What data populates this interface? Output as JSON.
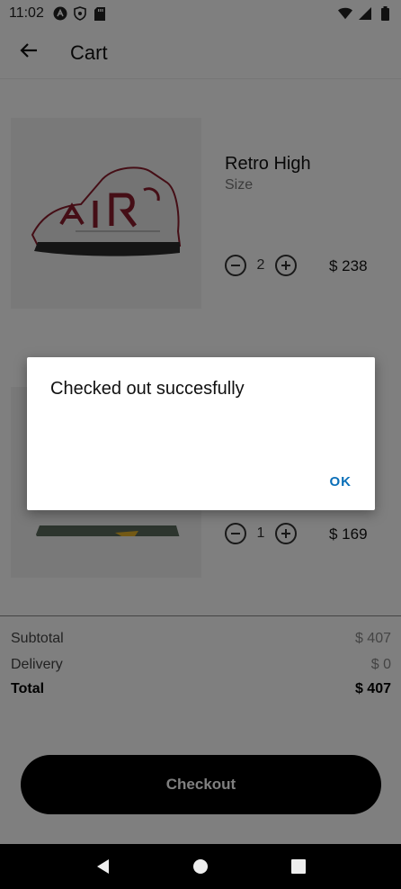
{
  "status_bar": {
    "time": "11:02",
    "left_icons": [
      "a-icon",
      "shield-icon",
      "sd-card-icon"
    ],
    "right_icons": [
      "wifi-icon",
      "signal-icon",
      "battery-icon"
    ]
  },
  "app_bar": {
    "title": "Cart"
  },
  "items": [
    {
      "name": "Retro High",
      "size_label": "Size",
      "qty": "2",
      "price": "$ 238",
      "image": "sneaker-retro-high"
    },
    {
      "name": "",
      "size_label": "",
      "qty": "1",
      "price": "$ 169",
      "image": "sneaker-green"
    }
  ],
  "summary": {
    "subtotal_label": "Subtotal",
    "subtotal_value": "$ 407",
    "delivery_label": "Delivery",
    "delivery_value": "$ 0",
    "total_label": "Total",
    "total_value": "$ 407"
  },
  "checkout": {
    "label": "Checkout"
  },
  "dialog": {
    "message": "Checked out succesfully",
    "ok_label": "OK"
  },
  "colors": {
    "accent": "#0a6fb8",
    "checkout_bg": "#000000",
    "scrim": "rgba(0,0,0,0.5)"
  }
}
